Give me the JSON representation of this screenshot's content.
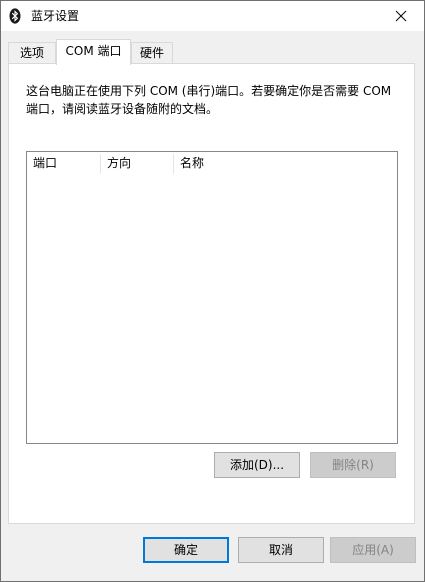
{
  "window": {
    "title": "蓝牙设置"
  },
  "tabs": [
    {
      "label": "选项"
    },
    {
      "label": "COM 端口"
    },
    {
      "label": "硬件"
    }
  ],
  "panel": {
    "description": "这台电脑正在使用下列 COM (串行)端口。若要确定你是否需要 COM 端口，请阅读蓝牙设备随附的文档。",
    "columns": [
      {
        "label": "端口"
      },
      {
        "label": "方向"
      },
      {
        "label": "名称"
      }
    ],
    "add_label": "添加(D)...",
    "remove_label": "删除(R)"
  },
  "footer": {
    "ok_label": "确定",
    "cancel_label": "取消",
    "apply_label": "应用(A)"
  },
  "icons": {
    "title": "bluetooth-icon",
    "close": "close-icon"
  },
  "colors": {
    "default_button_border": "#0078d7"
  }
}
